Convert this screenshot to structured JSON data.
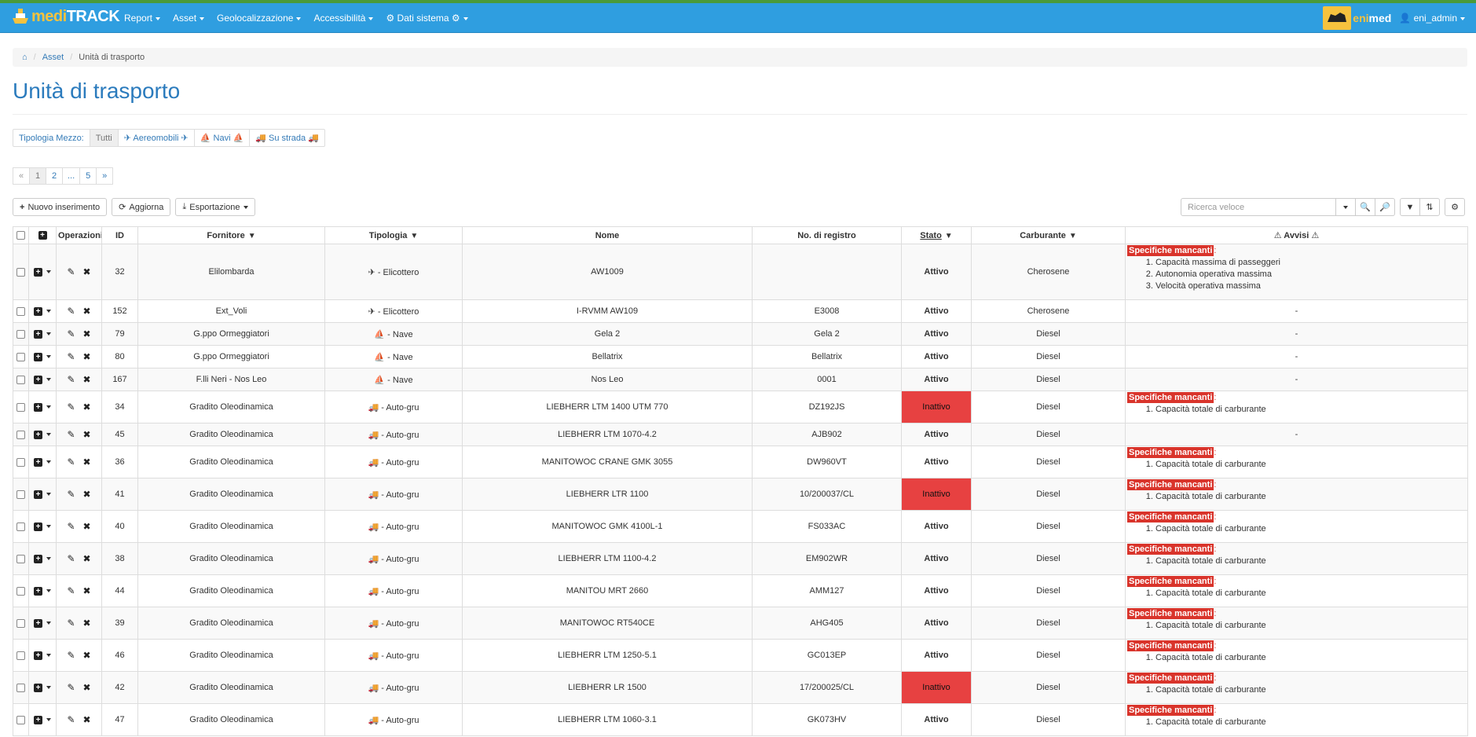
{
  "brand": {
    "name_part1": "medi",
    "name_part2": "TRACK"
  },
  "nav": {
    "items": [
      {
        "label": "Report"
      },
      {
        "label": "Asset"
      },
      {
        "label": "Geolocalizzazione"
      },
      {
        "label": "Accessibilità"
      },
      {
        "label": "⚙ Dati sistema ⚙"
      }
    ],
    "partner_part1": "eni",
    "partner_part2": "med",
    "user": "eni_admin"
  },
  "breadcrumb": {
    "level1": "Asset",
    "current": "Unità di trasporto"
  },
  "page_title": "Unità di trasporto",
  "filter": {
    "label": "Tipologia Mezzo:",
    "options": [
      {
        "label": "Tutti"
      },
      {
        "label": "✈ Aereomobili ✈"
      },
      {
        "label": "⛵ Navi ⛵"
      },
      {
        "label": "🚚 Su strada 🚚"
      }
    ]
  },
  "pagination": {
    "prev": "«",
    "pages": [
      "1",
      "2",
      "...",
      "5"
    ],
    "next": "»"
  },
  "toolbar": {
    "new_label": "Nuovo inserimento",
    "refresh_label": "Aggiorna",
    "export_label": "Esportazione",
    "search_placeholder": "Ricerca veloce"
  },
  "table": {
    "headers": {
      "operazioni": "Operazioni",
      "id": "ID",
      "fornitore": "Fornitore",
      "tipologia": "Tipologia",
      "nome": "Nome",
      "registro": "No. di registro",
      "stato": "Stato",
      "carburante": "Carburante",
      "avvisi": "⚠ Avvisi ⚠"
    },
    "missing_label": "Specifiche mancanti",
    "rows": [
      {
        "id": "32",
        "fornitore": "Elilombarda",
        "tipologia": "✈ - Elicottero",
        "nome": "AW1009",
        "registro": "",
        "stato": "Attivo",
        "carburante": "Cherosene",
        "avvisi": [
          "Capacità massima di passeggeri",
          "Autonomia operativa massima",
          "Velocità operativa massima"
        ]
      },
      {
        "id": "152",
        "fornitore": "Ext_Voli",
        "tipologia": "✈ - Elicottero",
        "nome": "I-RVMM AW109",
        "registro": "E3008",
        "stato": "Attivo",
        "carburante": "Cherosene",
        "avvisi": []
      },
      {
        "id": "79",
        "fornitore": "G.ppo Ormeggiatori",
        "tipologia": "⛵ - Nave",
        "nome": "Gela 2",
        "registro": "Gela 2",
        "stato": "Attivo",
        "carburante": "Diesel",
        "avvisi": []
      },
      {
        "id": "80",
        "fornitore": "G.ppo Ormeggiatori",
        "tipologia": "⛵ - Nave",
        "nome": "Bellatrix",
        "registro": "Bellatrix",
        "stato": "Attivo",
        "carburante": "Diesel",
        "avvisi": []
      },
      {
        "id": "167",
        "fornitore": "F.lli Neri - Nos Leo",
        "tipologia": "⛵ - Nave",
        "nome": "Nos Leo",
        "registro": "0001",
        "stato": "Attivo",
        "carburante": "Diesel",
        "avvisi": []
      },
      {
        "id": "34",
        "fornitore": "Gradito Oleodinamica",
        "tipologia": "🚚 - Auto-gru",
        "nome": "LIEBHERR LTM 1400 UTM 770",
        "registro": "DZ192JS",
        "stato": "Inattivo",
        "carburante": "Diesel",
        "avvisi": [
          "Capacità totale di carburante"
        ]
      },
      {
        "id": "45",
        "fornitore": "Gradito Oleodinamica",
        "tipologia": "🚚 - Auto-gru",
        "nome": "LIEBHERR LTM 1070-4.2",
        "registro": "AJB902",
        "stato": "Attivo",
        "carburante": "Diesel",
        "avvisi": []
      },
      {
        "id": "36",
        "fornitore": "Gradito Oleodinamica",
        "tipologia": "🚚 - Auto-gru",
        "nome": "MANITOWOC CRANE GMK 3055",
        "registro": "DW960VT",
        "stato": "Attivo",
        "carburante": "Diesel",
        "avvisi": [
          "Capacità totale di carburante"
        ]
      },
      {
        "id": "41",
        "fornitore": "Gradito Oleodinamica",
        "tipologia": "🚚 - Auto-gru",
        "nome": "LIEBHERR LTR 1100",
        "registro": "10/200037/CL",
        "stato": "Inattivo",
        "carburante": "Diesel",
        "avvisi": [
          "Capacità totale di carburante"
        ]
      },
      {
        "id": "40",
        "fornitore": "Gradito Oleodinamica",
        "tipologia": "🚚 - Auto-gru",
        "nome": "MANITOWOC GMK 4100L-1",
        "registro": "FS033AC",
        "stato": "Attivo",
        "carburante": "Diesel",
        "avvisi": [
          "Capacità totale di carburante"
        ]
      },
      {
        "id": "38",
        "fornitore": "Gradito Oleodinamica",
        "tipologia": "🚚 - Auto-gru",
        "nome": "LIEBHERR LTM 1100-4.2",
        "registro": "EM902WR",
        "stato": "Attivo",
        "carburante": "Diesel",
        "avvisi": [
          "Capacità totale di carburante"
        ]
      },
      {
        "id": "44",
        "fornitore": "Gradito Oleodinamica",
        "tipologia": "🚚 - Auto-gru",
        "nome": "MANITOU MRT 2660",
        "registro": "AMM127",
        "stato": "Attivo",
        "carburante": "Diesel",
        "avvisi": [
          "Capacità totale di carburante"
        ]
      },
      {
        "id": "39",
        "fornitore": "Gradito Oleodinamica",
        "tipologia": "🚚 - Auto-gru",
        "nome": "MANITOWOC RT540CE",
        "registro": "AHG405",
        "stato": "Attivo",
        "carburante": "Diesel",
        "avvisi": [
          "Capacità totale di carburante"
        ]
      },
      {
        "id": "46",
        "fornitore": "Gradito Oleodinamica",
        "tipologia": "🚚 - Auto-gru",
        "nome": "LIEBHERR LTM 1250-5.1",
        "registro": "GC013EP",
        "stato": "Attivo",
        "carburante": "Diesel",
        "avvisi": [
          "Capacità totale di carburante"
        ]
      },
      {
        "id": "42",
        "fornitore": "Gradito Oleodinamica",
        "tipologia": "🚚 - Auto-gru",
        "nome": "LIEBHERR LR 1500",
        "registro": "17/200025/CL",
        "stato": "Inattivo",
        "carburante": "Diesel",
        "avvisi": [
          "Capacità totale di carburante"
        ]
      },
      {
        "id": "47",
        "fornitore": "Gradito Oleodinamica",
        "tipologia": "🚚 - Auto-gru",
        "nome": "LIEBHERR LTM 1060-3.1",
        "registro": "GK073HV",
        "stato": "Attivo",
        "carburante": "Diesel",
        "avvisi": [
          "Capacità totale di carburante"
        ]
      }
    ]
  },
  "colors": {
    "navbar": "#2f9ee0",
    "inactive": "#e74141",
    "missing": "#d9342b",
    "title": "#2b7bbd"
  }
}
